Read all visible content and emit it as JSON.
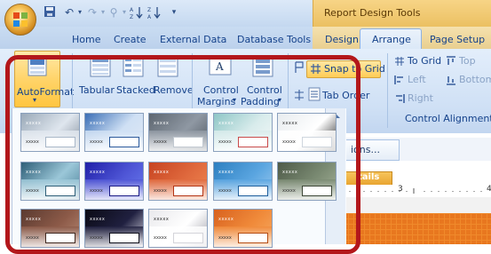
{
  "window": {
    "context_title": "Report Design Tools"
  },
  "tabs": {
    "home": "Home",
    "create": "Create",
    "external_data": "External Data",
    "database_tools": "Database Tools",
    "design": "Design",
    "arrange": "Arrange",
    "page_setup": "Page Setup"
  },
  "ribbon": {
    "autoformat": "AutoFormat",
    "tabular": "Tabular",
    "stacked": "Stacked",
    "remove": "Remove",
    "control": "Control",
    "margins": "Margins",
    "padding": "Padding",
    "snap_to_grid": "Snap to Grid",
    "tab_order": "Tab Order",
    "to_grid": "To Grid",
    "top": "Top",
    "left": "Left",
    "bottom": "Bottom",
    "right": "Right",
    "control_alignment": "Control Alignment"
  },
  "form": {
    "properties_label": "ions...",
    "details_label": "tails",
    "ruler_numbers": [
      "3",
      "4"
    ]
  },
  "gallery": {
    "caption": "xxxxx",
    "thumb_themes": [
      [
        "#9aa9b8",
        "#dfe6ee",
        "#7f8b99",
        "#a8b7c8"
      ],
      [
        "#3b6fb6",
        "#cfe0f4",
        "#e0e8f3",
        "#2c5a9c"
      ],
      [
        "#5d6670",
        "#8f98a3",
        "#4f5861",
        "#c2c9d1"
      ],
      [
        "#8ec6c6",
        "#d9ecec",
        "#f3f8f8",
        "#c94b4b"
      ],
      [
        "#e8ecef",
        "#ffffff",
        "#1b1b1b",
        "#cfd6de"
      ],
      [
        "#2f5f78",
        "#9bc7d8",
        "#4a7f98",
        "#2f5f78"
      ],
      [
        "#2020a8",
        "#4f56d6",
        "#6a7df0",
        "#1c1c86"
      ],
      [
        "#c74421",
        "#e06a3e",
        "#f08850",
        "#b33515"
      ],
      [
        "#2d7fc0",
        "#5aa5e0",
        "#9ccaf0",
        "#1f5f9c"
      ],
      [
        "#4e5a48",
        "#7a8a72",
        "#a6b39a",
        "#3c4636"
      ],
      [
        "#5a3a30",
        "#8c5a48",
        "#b88a74",
        "#402820"
      ],
      [
        "#0a0a14",
        "#202040",
        "#dcdce8",
        "#10101c"
      ],
      [
        "#e9e9ec",
        "#ffffff",
        "#9b9ba6",
        "#d4d4da"
      ],
      [
        "#d8621f",
        "#f08a3a",
        "#f7ab62",
        "#b54c12"
      ]
    ]
  }
}
